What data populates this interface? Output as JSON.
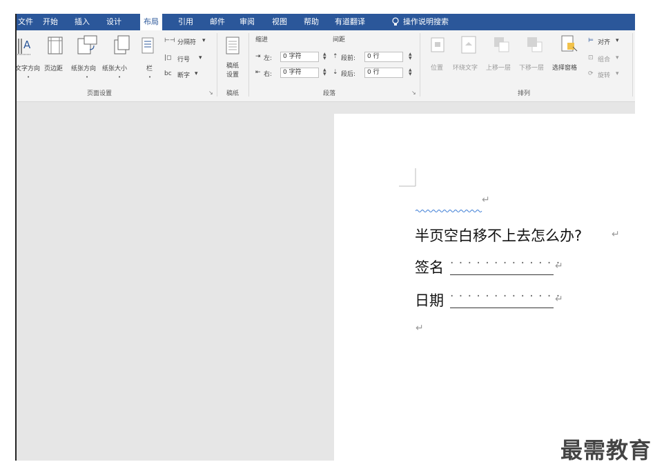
{
  "tabs": [
    "文件",
    "开始",
    "插入",
    "设计",
    "布局",
    "引用",
    "邮件",
    "审阅",
    "视图",
    "帮助",
    "有道翻译",
    "操作说明搜索"
  ],
  "active_tab": "布局",
  "ribbon": {
    "page_setup": {
      "buttons": [
        "文字方向",
        "页边距",
        "纸张方向",
        "纸张大小",
        "栏"
      ],
      "small": [
        "分隔符",
        "行号",
        "断字"
      ],
      "group_label": "页面设置"
    },
    "manuscript": {
      "button_line1": "稿纸",
      "button_line2": "设置",
      "group_label": "稿纸"
    },
    "paragraph": {
      "indent_header": "缩进",
      "spacing_header": "间距",
      "indent_left_label": "左:",
      "indent_left_value": "0 字符",
      "indent_right_label": "右:",
      "indent_right_value": "0 字符",
      "spacing_before_label": "段前:",
      "spacing_before_value": "0 行",
      "spacing_after_label": "段后:",
      "spacing_after_value": "0 行",
      "group_label": "段落"
    },
    "arrange": {
      "buttons": [
        "位置",
        "环绕文字",
        "上移一层",
        "下移一层",
        "选择窗格"
      ],
      "small": [
        "对齐",
        "组合",
        "旋转"
      ],
      "group_label": "排列"
    }
  },
  "document": {
    "line1": "半页空白移不上去怎么办?",
    "line2_label": "签名",
    "line3_label": "日期",
    "return_mark": "↵",
    "dot_leader": "· · · · · · · · · · · · ·"
  },
  "watermark": "最需教育",
  "colors": {
    "tab_bar": "#2b579a",
    "ribbon": "#f3f3f3",
    "workspace": "#e6e6e6",
    "page": "#ffffff"
  }
}
